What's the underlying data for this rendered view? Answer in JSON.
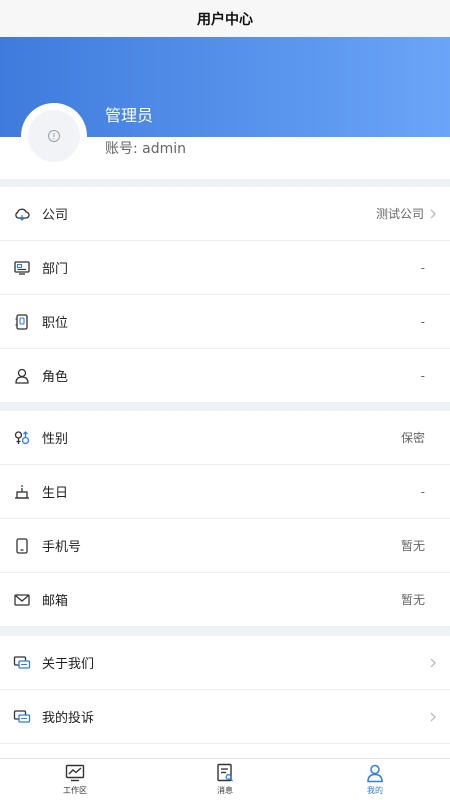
{
  "nav": {
    "title": "用户中心"
  },
  "profile": {
    "name": "管理员",
    "account": "账号: admin"
  },
  "colors": {
    "accent": "#2f7de1",
    "hero_start": "#3f7bdc",
    "hero_end": "#6aa5f8"
  },
  "groups": [
    [
      {
        "icon": "cloud-icon",
        "label": "公司",
        "value": "测试公司",
        "chevron": true
      },
      {
        "icon": "department-icon",
        "label": "部门",
        "value": "-",
        "chevron": false
      },
      {
        "icon": "position-icon",
        "label": "职位",
        "value": "-",
        "chevron": false
      },
      {
        "icon": "role-icon",
        "label": "角色",
        "value": "-",
        "chevron": false
      }
    ],
    [
      {
        "icon": "gender-icon",
        "label": "性别",
        "value": "保密",
        "chevron": false
      },
      {
        "icon": "birthday-icon",
        "label": "生日",
        "value": "-",
        "chevron": false
      },
      {
        "icon": "phone-icon",
        "label": "手机号",
        "value": "暂无",
        "chevron": false
      },
      {
        "icon": "mail-icon",
        "label": "邮箱",
        "value": "暂无",
        "chevron": false
      }
    ],
    [
      {
        "icon": "chat-icon",
        "label": "关于我们",
        "value": "",
        "chevron": true
      },
      {
        "icon": "chat-icon",
        "label": "我的投诉",
        "value": "",
        "chevron": true
      }
    ]
  ],
  "tabs": [
    {
      "icon": "chart-monitor-icon",
      "label": "工作区",
      "active": false
    },
    {
      "icon": "message-doc-icon",
      "label": "消息",
      "active": false
    },
    {
      "icon": "user-icon",
      "label": "我的",
      "active": true
    }
  ]
}
